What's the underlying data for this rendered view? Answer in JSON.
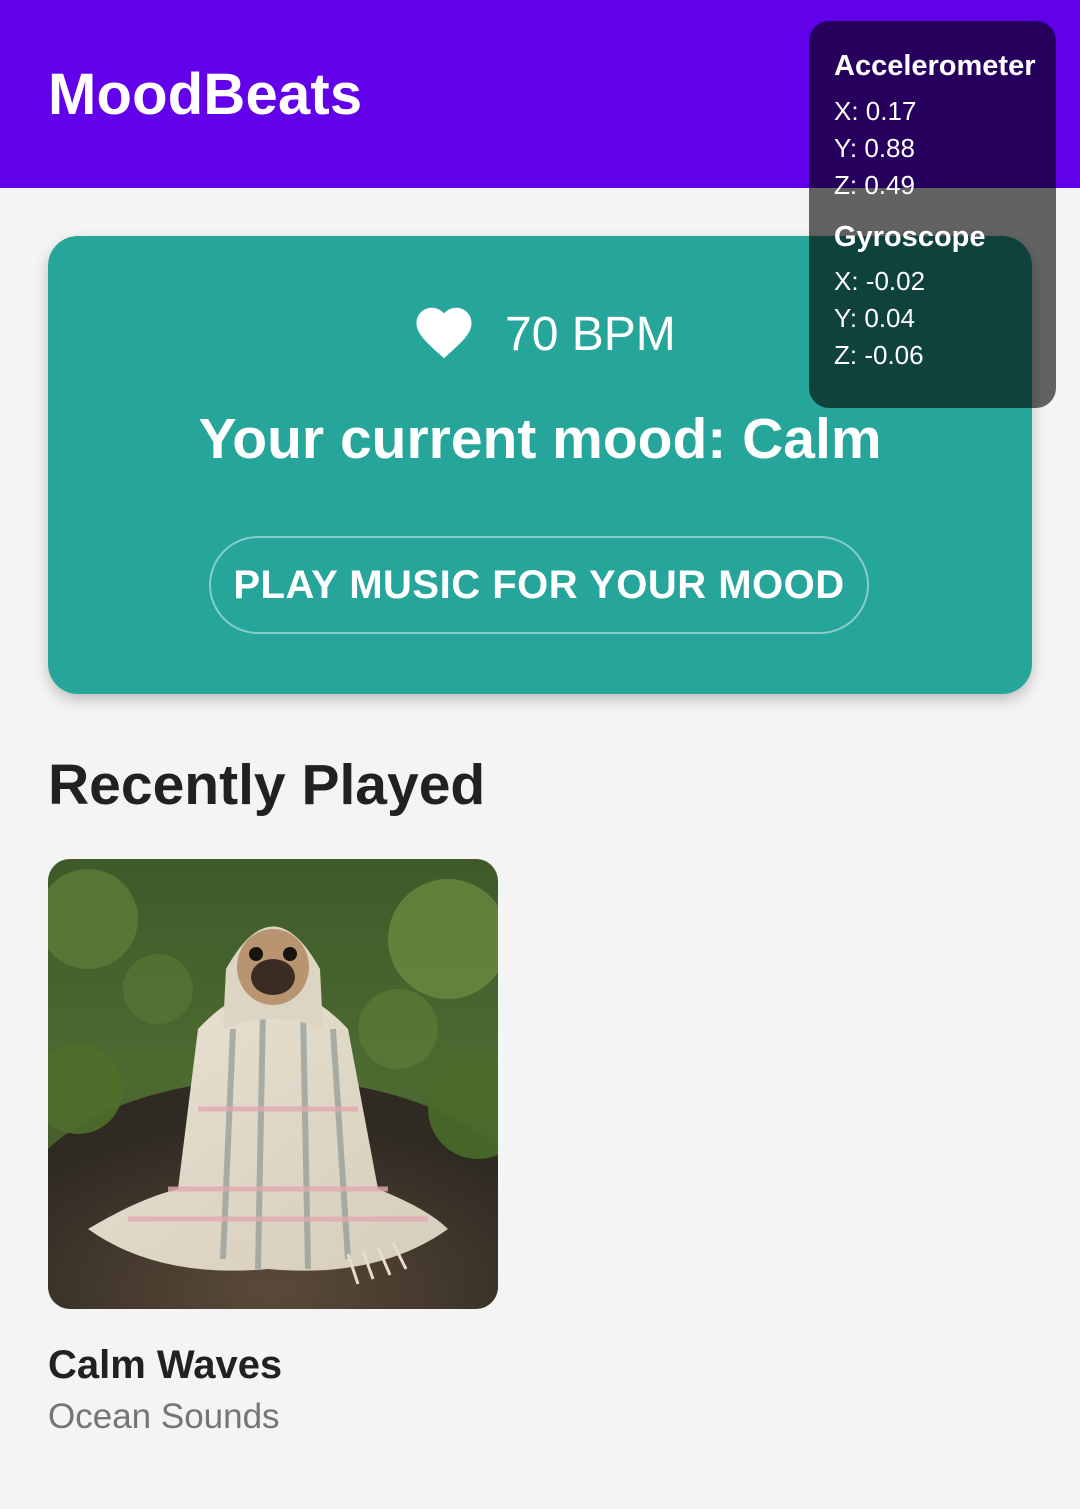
{
  "app_bar": {
    "title": "MoodBeats",
    "color": "#6200ea"
  },
  "mood_card": {
    "heart_rate": "70 BPM",
    "mood": "Your current mood: Calm",
    "play_button_label": "PLAY MUSIC FOR YOUR MOOD",
    "color": "#26a69a",
    "icon": "heart-icon"
  },
  "sensors": {
    "accelerometer": {
      "title": "Accelerometer",
      "x": "X: 0.17",
      "y": "Y: 0.88",
      "z": "Z: 0.49"
    },
    "gyroscope": {
      "title": "Gyroscope",
      "x": "X: -0.02",
      "y": "Y: 0.04",
      "z": "Z: -0.06"
    }
  },
  "recently_played": {
    "title": "Recently Played",
    "items": [
      {
        "title": "Calm Waves",
        "artist": "Ocean Sounds",
        "artwork": "pug-in-blanket-photo"
      }
    ]
  }
}
